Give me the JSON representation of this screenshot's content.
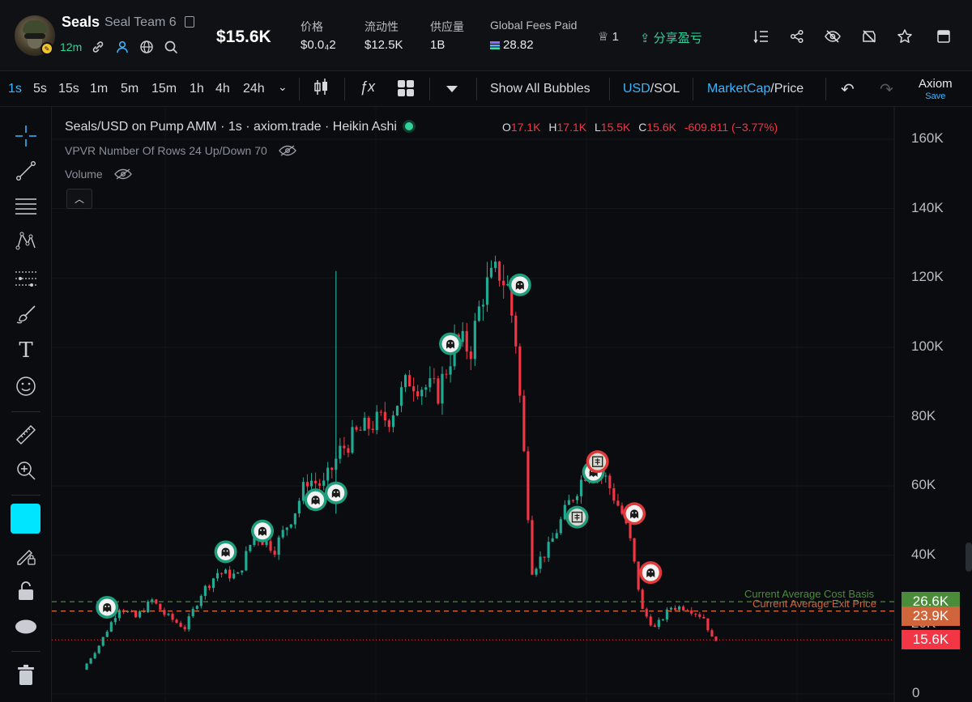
{
  "token": {
    "symbol": "Seals",
    "name": "Seal Team 6",
    "age": "12m",
    "price": "$15.6K"
  },
  "stats": [
    {
      "label": "价格",
      "value": "$0.0₄2"
    },
    {
      "label": "流动性",
      "value": "$12.5K"
    },
    {
      "label": "供应量",
      "value": "1B"
    },
    {
      "label": "Global Fees Paid",
      "value": "28.82"
    }
  ],
  "top_right": {
    "holders_count": "1",
    "share_pnl": "分享盈亏"
  },
  "timeframes": [
    "1s",
    "5s",
    "15s",
    "1m",
    "5m",
    "15m",
    "1h",
    "4h",
    "24h"
  ],
  "toolbar": {
    "show_bubbles": "Show All Bubbles",
    "currency_a": "USD",
    "currency_sep": "/",
    "currency_b": "SOL",
    "metric_a": "MarketCap",
    "metric_sep": "/",
    "metric_b": "Price",
    "axiom": "Axiom",
    "save": "Save"
  },
  "chart_header": {
    "title": "Seals/USD on Pump AMM · 1s · axiom.trade · Heikin Ashi",
    "o_label": "O",
    "o": "17.1K",
    "h_label": "H",
    "h": "17.1K",
    "l_label": "L",
    "l": "15.5K",
    "c_label": "C",
    "c": "15.6K",
    "change": "-609.811 (−3.77%)",
    "vpvr": "VPVR Number Of Rows 24 Up/Down 70",
    "volume": "Volume"
  },
  "colors": {
    "up": "#22ab94",
    "down": "#f23645",
    "accent": "#38b6ff",
    "cost_basis": "#4a8c3a",
    "exit_price": "#d0643a"
  },
  "chart_data": {
    "type": "candlestick",
    "y_unit": "market cap (USD)",
    "ylim": [
      0,
      170000
    ],
    "y_ticks": [
      "160K",
      "140K",
      "120K",
      "100K",
      "80K",
      "60K",
      "40K",
      "20K",
      "0"
    ],
    "y_tick_values": [
      160000,
      140000,
      120000,
      100000,
      80000,
      60000,
      40000,
      20000,
      0
    ],
    "price_path": [
      [
        0,
        7000
      ],
      [
        4,
        14000
      ],
      [
        9,
        25000
      ],
      [
        13,
        22000
      ],
      [
        17,
        27000
      ],
      [
        20,
        23000
      ],
      [
        25,
        19000
      ],
      [
        29,
        29000
      ],
      [
        33,
        35000
      ],
      [
        38,
        34000
      ],
      [
        42,
        46000
      ],
      [
        47,
        42000
      ],
      [
        52,
        53000
      ],
      [
        55,
        62000
      ],
      [
        59,
        60000
      ],
      [
        63,
        70000
      ],
      [
        67,
        75000
      ],
      [
        71,
        78000
      ],
      [
        75,
        80000
      ],
      [
        80,
        91000
      ],
      [
        83,
        89000
      ],
      [
        87,
        87000
      ],
      [
        91,
        101000
      ],
      [
        95,
        100000
      ],
      [
        98,
        116000
      ],
      [
        102,
        122000
      ],
      [
        104,
        117000
      ],
      [
        106,
        102000
      ],
      [
        110,
        36000
      ],
      [
        114,
        42000
      ],
      [
        119,
        55000
      ],
      [
        124,
        66000
      ],
      [
        128,
        62000
      ],
      [
        132,
        52000
      ],
      [
        134,
        44000
      ],
      [
        137,
        24000
      ],
      [
        140,
        19000
      ],
      [
        144,
        25000
      ],
      [
        148,
        25000
      ],
      [
        152,
        22000
      ],
      [
        154,
        16000
      ]
    ],
    "spike_high": 122000,
    "lines": [
      {
        "label": "Current Average Cost Basis",
        "value": 26600,
        "tag": "26.6K"
      },
      {
        "label": "Current Average Exit Price",
        "value": 23900,
        "tag": "23.9K"
      },
      {
        "label": "Last",
        "value": 15600,
        "tag": "15.6K"
      }
    ],
    "bubbles": [
      {
        "x": 6,
        "y": 25000,
        "side": "buy",
        "icon": "ghost"
      },
      {
        "x": 35,
        "y": 41000,
        "side": "buy",
        "icon": "ghost"
      },
      {
        "x": 44,
        "y": 47000,
        "side": "buy",
        "icon": "ghost"
      },
      {
        "x": 57,
        "y": 56000,
        "side": "buy",
        "icon": "ghost"
      },
      {
        "x": 62,
        "y": 58000,
        "side": "buy",
        "icon": "ghost"
      },
      {
        "x": 90,
        "y": 101000,
        "side": "buy",
        "icon": "ghost"
      },
      {
        "x": 107,
        "y": 118000,
        "side": "buy",
        "icon": "ghost"
      },
      {
        "x": 121,
        "y": 51000,
        "side": "buy",
        "icon": "seal"
      },
      {
        "x": 125,
        "y": 64000,
        "side": "buy",
        "icon": "ghost"
      },
      {
        "x": 126,
        "y": 67000,
        "side": "sell",
        "icon": "seal"
      },
      {
        "x": 135,
        "y": 52000,
        "side": "sell",
        "icon": "ghost"
      },
      {
        "x": 139,
        "y": 35000,
        "side": "sell",
        "icon": "ghost"
      }
    ]
  }
}
